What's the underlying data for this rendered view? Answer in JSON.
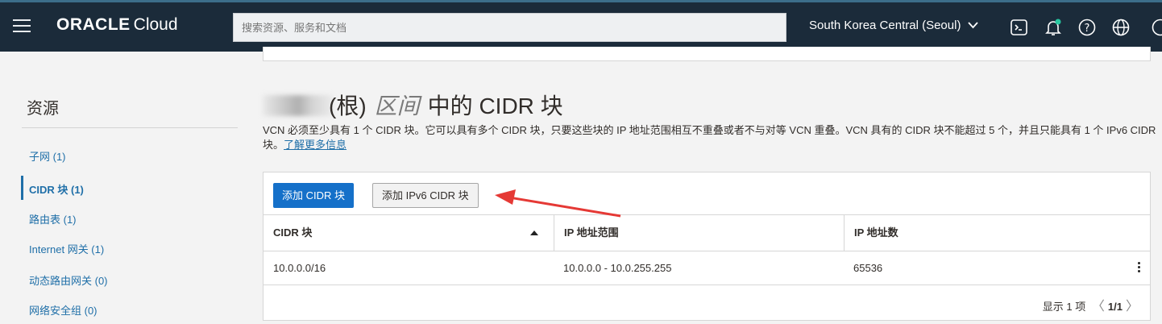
{
  "header": {
    "brand_main": "ORACLE",
    "brand_sub": "Cloud",
    "search_placeholder": "搜索资源、服务和文档",
    "region": "South Korea Central (Seoul)",
    "icons": [
      "menu-icon",
      "cloud-shell-icon",
      "bell-icon",
      "help-icon",
      "globe-icon"
    ]
  },
  "sidebar": {
    "title": "资源",
    "items": [
      {
        "label": "子网 (1)"
      },
      {
        "label": "CIDR 块 (1)"
      },
      {
        "label": "路由表 (1)"
      },
      {
        "label": "Internet 网关 (1)"
      },
      {
        "label": "动态路由网关 (0)"
      },
      {
        "label": "网络安全组 (0)"
      }
    ]
  },
  "main": {
    "heading_paren": "(根)",
    "heading_italic": "区间",
    "heading_rest": "中的 CIDR 块",
    "description": "VCN 必须至少具有 1 个 CIDR 块。它可以具有多个 CIDR 块，只要这些块的 IP 地址范围相互不重叠或者不与对等 VCN 重叠。VCN 具有的 CIDR 块不能超过 5 个，并且只能具有 1 个 IPv6 CIDR 块。",
    "learn_more": "了解更多信息"
  },
  "toolbar": {
    "add_cidr": "添加 CIDR 块",
    "add_ipv6": "添加 IPv6 CIDR 块"
  },
  "table": {
    "columns": [
      "CIDR 块",
      "IP 地址范围",
      "IP 地址数"
    ],
    "rows": [
      {
        "cidr": "10.0.0.0/16",
        "range": "10.0.0.0 - 10.0.255.255",
        "count": "65536"
      }
    ],
    "footer_text": "显示 1 项",
    "page": "1/1"
  },
  "colors": {
    "nav_bg": "#1b2b3a",
    "primary": "#1570c9",
    "link": "#1f6fa8",
    "annotation_arrow": "#e53935"
  }
}
